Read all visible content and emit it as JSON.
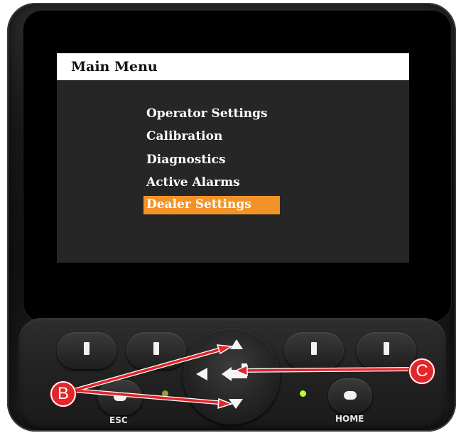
{
  "screen": {
    "title": "Main Menu",
    "menu_items": [
      {
        "label": "Operator Settings",
        "selected": false
      },
      {
        "label": "Calibration",
        "selected": false
      },
      {
        "label": "Diagnostics",
        "selected": false
      },
      {
        "label": "Active Alarms",
        "selected": false
      },
      {
        "label": "Dealer Settings",
        "selected": true
      }
    ],
    "selection_color": "#f39327"
  },
  "keypad": {
    "esc_label": "ESC",
    "home_label": "HOME",
    "led_color": "#b8ff3a"
  },
  "callouts": {
    "b_label": "B",
    "c_label": "C",
    "color": "#e3262a"
  }
}
